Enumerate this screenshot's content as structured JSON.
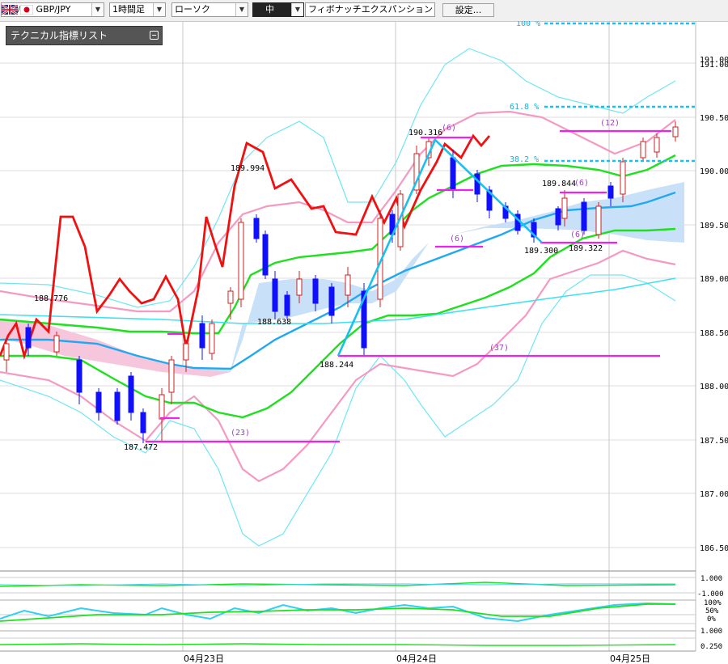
{
  "toolbar": {
    "symbol": "GBP/JPY",
    "timeframe": "1時間足",
    "chart_type": "ローソク",
    "size": "中",
    "drawing_tool": "フィボナッチエクスパンション",
    "settings_label": "設定..."
  },
  "indicator_panel": {
    "title": "テクニカル指標リスト"
  },
  "price_axis": {
    "labels": [
      "191.00",
      "190.50",
      "190.00",
      "189.50",
      "189.00",
      "188.50",
      "188.00",
      "187.50",
      "187.00",
      "186.50"
    ],
    "top_label": "191.00"
  },
  "time_axis": {
    "labels": [
      "04月23日",
      "04月24日",
      "04月25日"
    ]
  },
  "sub_axis": {
    "labels": [
      "1.000",
      "-1.000",
      "100%",
      "50%",
      "0%",
      "1.000",
      "0.250"
    ]
  },
  "annotations": {
    "price_marks": [
      "188.776",
      "187.472",
      "189.994",
      "188.638",
      "188.244",
      "190.316",
      "189.300",
      "189.844",
      "189.322"
    ],
    "counts": [
      "(23)",
      "(6)",
      "(6)",
      "(37)",
      "(6)",
      "(12)",
      "(6)"
    ],
    "fib_levels": [
      "100 %",
      "61.8 %",
      "38.2 %"
    ]
  },
  "colors": {
    "up_candle": "#d02020",
    "down_candle": "#1010ff",
    "cloud": "#c8e0f8",
    "cloud_pink": "#f6c6dc",
    "bollinger_outer": "#6fe6f2",
    "bollinger_inner": "#f49ac2",
    "ma_green": "#1ee01e",
    "ma_blue": "#20a8f0",
    "chikou": "#f01010",
    "horizontal_line": "#ee22ee",
    "fib_line": "#18c0f0"
  }
}
